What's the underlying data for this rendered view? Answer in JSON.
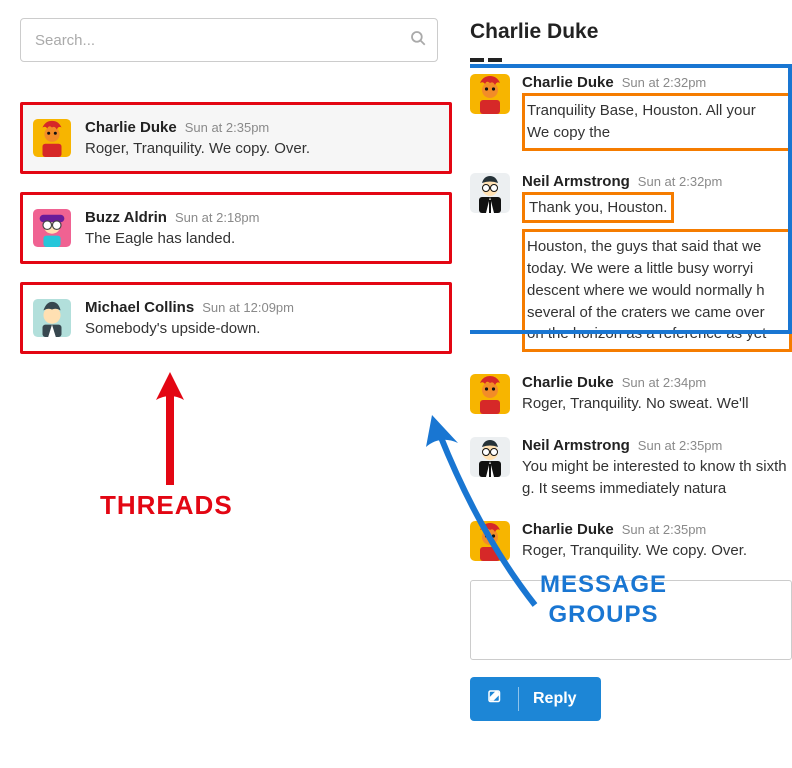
{
  "search": {
    "placeholder": "Search..."
  },
  "threads": [
    {
      "name": "Charlie Duke",
      "time": "Sun at 2:35pm",
      "preview": "Roger, Tranquility. We copy. Over.",
      "avatar": "charlie",
      "selected": true
    },
    {
      "name": "Buzz Aldrin",
      "time": "Sun at 2:18pm",
      "preview": "The Eagle has landed.",
      "avatar": "buzz",
      "selected": false
    },
    {
      "name": "Michael Collins",
      "time": "Sun at 12:09pm",
      "preview": "Somebody's upside-down.",
      "avatar": "michael",
      "selected": false
    }
  ],
  "conversation": {
    "title": "Charlie Duke",
    "messages": [
      {
        "author": "Charlie Duke",
        "avatar": "charlie",
        "time": "Sun at 2:32pm",
        "texts": [
          "Tranquility Base, Houston. All your",
          "We copy the"
        ],
        "orange_boxes": [
          0,
          1
        ],
        "in_blue_group": true
      },
      {
        "author": "Neil Armstrong",
        "avatar": "neil",
        "time": "Sun at 2:32pm",
        "texts": [
          "Thank you, Houston.",
          "Houston, the guys that said that we today. We were a little busy worryi descent where we would normally h several of the craters we came over on the horizon as a reference as yet"
        ],
        "orange_boxes": [
          0,
          1
        ],
        "in_blue_group": true
      },
      {
        "author": "Charlie Duke",
        "avatar": "charlie",
        "time": "Sun at 2:34pm",
        "texts": [
          "Roger, Tranquility. No sweat. We'll"
        ],
        "orange_boxes": [],
        "in_blue_group": false
      },
      {
        "author": "Neil Armstrong",
        "avatar": "neil",
        "time": "Sun at 2:35pm",
        "texts": [
          "You might be interested to know th sixth g. It seems immediately natura"
        ],
        "orange_boxes": [],
        "in_blue_group": false
      },
      {
        "author": "Charlie Duke",
        "avatar": "charlie",
        "time": "Sun at 2:35pm",
        "texts": [
          "Roger, Tranquility. We copy. Over."
        ],
        "orange_boxes": [],
        "in_blue_group": false
      }
    ],
    "reply_label": "Reply"
  },
  "annotations": {
    "left_label": "THREADS",
    "right_label_line1": "MESSAGE",
    "right_label_line2": "GROUPS"
  }
}
